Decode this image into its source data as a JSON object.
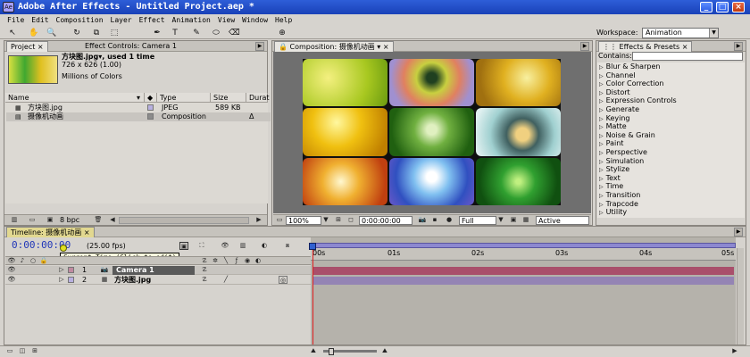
{
  "titlebar": {
    "title": "Adobe After Effects - Untitled Project.aep *",
    "app_icon_text": "Ae",
    "minimize": "_",
    "maximize": "□",
    "close": "×"
  },
  "menu": [
    "File",
    "Edit",
    "Composition",
    "Layer",
    "Effect",
    "Animation",
    "View",
    "Window",
    "Help"
  ],
  "toolbar": {
    "tools": [
      "↖",
      "✋",
      "🔍",
      "↻",
      "⧉",
      "⬚",
      "✒",
      "T",
      "✎",
      "⬭",
      "⌫"
    ],
    "workspace_label": "Workspace:",
    "workspace_value": "Animation"
  },
  "project": {
    "tab_project": "Project",
    "tab_close": "×",
    "tab_effect_controls": "Effect Controls: Camera 1",
    "selected_name": "方块图.jpg▾, used 1 time",
    "dimensions": "726 x 626 (1.00)",
    "color_info": "Millions of Colors",
    "columns": [
      "Name",
      "Type",
      "Size",
      "Durat"
    ],
    "rows": [
      {
        "name": "方块图.jpg",
        "type": "JPEG",
        "size": "589 KB",
        "dur": "",
        "color": "#b8b0e0"
      },
      {
        "name": "摄像机动画",
        "type": "Composition",
        "size": "",
        "dur": "Δ",
        "color": "#8c8c8c"
      }
    ],
    "bpc": "8 bpc"
  },
  "composition": {
    "tab": "Composition: 摄像机动画",
    "zoom": "100%",
    "timecode": "0:00:00:00",
    "resolution": "Full",
    "camera": "Active Camera"
  },
  "effects": {
    "tab": "Effects & Presets",
    "contains_label": "Contains:",
    "items": [
      "Blur & Sharpen",
      "Channel",
      "Color Correction",
      "Distort",
      "Expression Controls",
      "Generate",
      "Keying",
      "Matte",
      "Noise & Grain",
      "Paint",
      "Perspective",
      "Simulation",
      "Stylize",
      "Text",
      "Time",
      "Transition",
      "Trapcode",
      "Utility"
    ]
  },
  "timeline": {
    "tab": "Timeline: 摄像机动画",
    "timecode": "0:00:00:00",
    "fps": "(25.00 fps)",
    "tooltip": "Current Time (Click to edit)",
    "ruler": [
      "00s",
      "01s",
      "02s",
      "03s",
      "04s",
      "05s"
    ],
    "layers": [
      {
        "num": "1",
        "name": "Camera 1",
        "color": "#c08aa0"
      },
      {
        "num": "2",
        "name": "方块图.jpg",
        "color": "#b8b0e0"
      }
    ]
  },
  "colors": {
    "layer1_bar": "#a94f6b",
    "layer2_bar": "#9484b4",
    "playhead": "#e02020",
    "accent_blue": "#1941b8"
  }
}
